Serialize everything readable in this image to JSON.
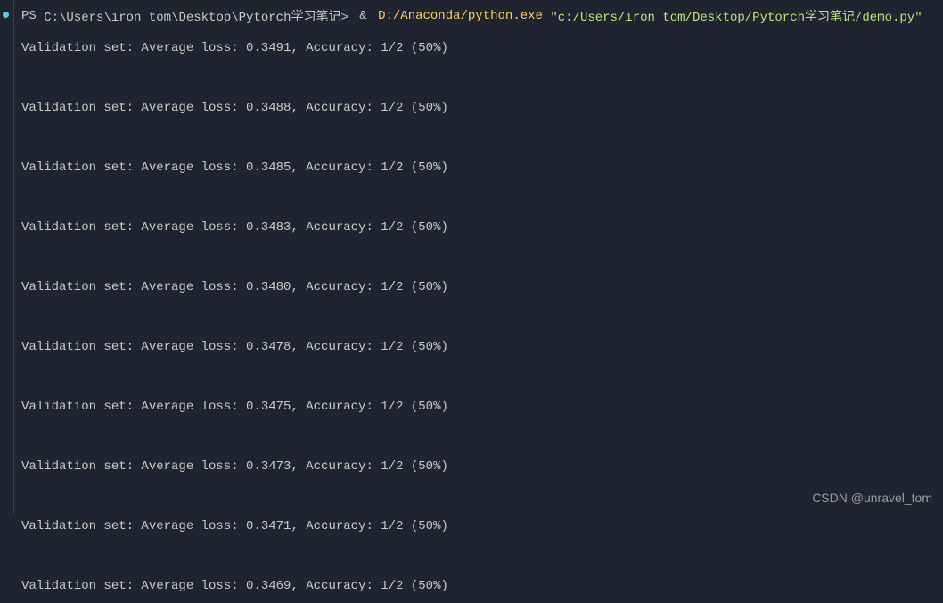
{
  "terminal": {
    "prompt": {
      "shell": "PS",
      "cwd": "C:\\Users\\iron tom\\Desktop\\Pytorch学习笔记>",
      "amp": "&",
      "executable": "D:/Anaconda/python.exe",
      "script_arg": "\"c:/Users/iron tom/Desktop/Pytorch学习笔记/demo.py\""
    },
    "output_lines": [
      "Validation set: Average loss: 0.3491, Accuracy: 1/2 (50%)",
      "Validation set: Average loss: 0.3488, Accuracy: 1/2 (50%)",
      "Validation set: Average loss: 0.3485, Accuracy: 1/2 (50%)",
      "Validation set: Average loss: 0.3483, Accuracy: 1/2 (50%)",
      "Validation set: Average loss: 0.3480, Accuracy: 1/2 (50%)",
      "Validation set: Average loss: 0.3478, Accuracy: 1/2 (50%)",
      "Validation set: Average loss: 0.3475, Accuracy: 1/2 (50%)",
      "Validation set: Average loss: 0.3473, Accuracy: 1/2 (50%)",
      "Validation set: Average loss: 0.3471, Accuracy: 1/2 (50%)",
      "Validation set: Average loss: 0.3469, Accuracy: 1/2 (50%)"
    ]
  },
  "watermark": "CSDN @unravel_tom"
}
